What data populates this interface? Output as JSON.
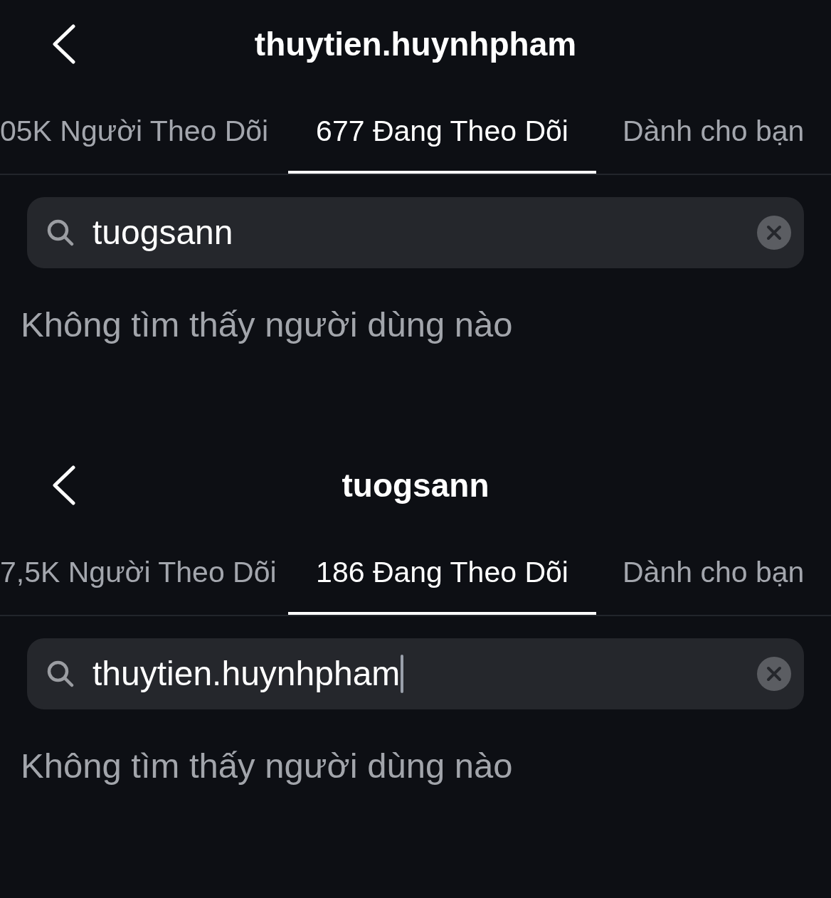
{
  "panels": [
    {
      "title": "thuytien.huynhpham",
      "tabs": [
        {
          "label": "05K Người Theo Dõi",
          "selected": false
        },
        {
          "label": "677 Đang Theo Dõi",
          "selected": true
        },
        {
          "label": "Dành cho bạn",
          "selected": false
        }
      ],
      "search": {
        "value": "tuogsann",
        "focused": false
      },
      "message": "Không tìm thấy người dùng nào"
    },
    {
      "title": "tuogsann",
      "tabs": [
        {
          "label": "7,5K Người Theo Dõi",
          "selected": false
        },
        {
          "label": "186 Đang Theo Dõi",
          "selected": true
        },
        {
          "label": "Dành cho bạn",
          "selected": false
        }
      ],
      "search": {
        "value": "thuytien.huynhpham",
        "focused": true
      },
      "message": "Không tìm thấy người dùng nào"
    }
  ]
}
